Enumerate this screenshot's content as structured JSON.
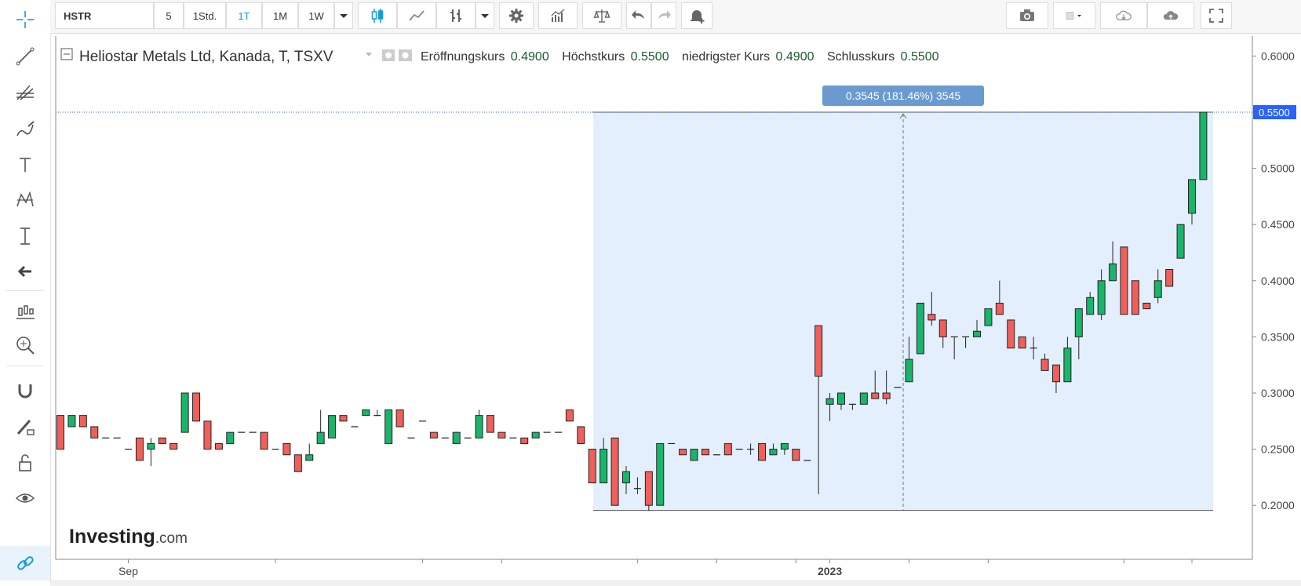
{
  "toolbar": {
    "symbol": "HSTR",
    "intervals": [
      "5",
      "1Std.",
      "1T",
      "1M",
      "1W"
    ],
    "active_interval": "1T",
    "icons": [
      "candles-icon",
      "line-chart-icon",
      "bars-icon",
      "dropdown-icon",
      "gear-icon",
      "indicators-icon",
      "compare-icon",
      "undo-icon",
      "redo-icon",
      "alert-icon",
      "camera-icon",
      "color-box-icon",
      "cloud-download-icon",
      "cloud-upload-icon",
      "fullscreen-icon"
    ]
  },
  "left_tools": [
    "crosshair-icon",
    "trend-line-icon",
    "fib-icon",
    "brush-icon",
    "text-icon",
    "pattern-icon",
    "measure-icon",
    "back-arrow-icon",
    "long-position-icon",
    "zoom-icon",
    "magnet-icon",
    "lock-pencil-icon",
    "lock-icon",
    "eye-icon",
    "link-icon"
  ],
  "legend": {
    "name": "Heliostar Metals Ltd, Kanada, T, TSXV",
    "items": [
      {
        "label": "Eröffnungskurs",
        "value": "0.4900"
      },
      {
        "label": "Höchstkurs",
        "value": "0.5500"
      },
      {
        "label": "niedrigster Kurs",
        "value": "0.4900"
      },
      {
        "label": "Schlusskurs",
        "value": "0.5500"
      }
    ]
  },
  "watermark": {
    "brand": "Investing",
    "suffix": ".com"
  },
  "measure": {
    "label": "0.3545 (181.46%) 3545",
    "low": 0.1955,
    "high": 0.55
  },
  "price_label": "0.5500",
  "colors": {
    "up": "#19b56b",
    "down": "#f0605a",
    "accent": "#2962ff",
    "measure_fill": "#e3effd",
    "measure_tag": "#6a9ad0"
  },
  "chart_data": {
    "type": "candlestick",
    "yaxis_ticks": [
      "0.6000",
      "0.5500",
      "0.5000",
      "0.4500",
      "0.4000",
      "0.3500",
      "0.3000",
      "0.2500",
      "0.2000"
    ],
    "ylim": [
      0.15,
      0.61
    ],
    "xaxis_labels": [
      {
        "label": "Sep",
        "bar": 6
      },
      {
        "label": "2023",
        "bar": 68
      }
    ],
    "candles": [
      [
        0.28,
        0.28,
        0.25,
        0.25
      ],
      [
        0.27,
        0.28,
        0.27,
        0.28
      ],
      [
        0.28,
        0.28,
        0.27,
        0.27
      ],
      [
        0.27,
        0.27,
        0.26,
        0.26
      ],
      [
        0.26,
        0.26,
        0.26,
        0.26
      ],
      [
        0.26,
        0.26,
        0.26,
        0.26
      ],
      [
        0.25,
        0.25,
        0.25,
        0.25
      ],
      [
        0.26,
        0.26,
        0.24,
        0.24
      ],
      [
        0.25,
        0.26,
        0.235,
        0.255
      ],
      [
        0.26,
        0.26,
        0.255,
        0.255
      ],
      [
        0.255,
        0.255,
        0.25,
        0.25
      ],
      [
        0.265,
        0.3,
        0.265,
        0.3
      ],
      [
        0.3,
        0.3,
        0.275,
        0.275
      ],
      [
        0.275,
        0.275,
        0.25,
        0.25
      ],
      [
        0.255,
        0.255,
        0.25,
        0.25
      ],
      [
        0.255,
        0.265,
        0.255,
        0.265
      ],
      [
        0.265,
        0.265,
        0.265,
        0.265
      ],
      [
        0.265,
        0.265,
        0.265,
        0.265
      ],
      [
        0.265,
        0.265,
        0.25,
        0.25
      ],
      [
        0.25,
        0.25,
        0.25,
        0.25
      ],
      [
        0.255,
        0.255,
        0.245,
        0.245
      ],
      [
        0.245,
        0.245,
        0.23,
        0.23
      ],
      [
        0.24,
        0.255,
        0.24,
        0.245
      ],
      [
        0.255,
        0.285,
        0.255,
        0.265
      ],
      [
        0.26,
        0.28,
        0.26,
        0.28
      ],
      [
        0.28,
        0.28,
        0.275,
        0.275
      ],
      [
        0.27,
        0.27,
        0.27,
        0.27
      ],
      [
        0.28,
        0.285,
        0.28,
        0.285
      ],
      [
        0.28,
        0.285,
        0.28,
        0.28
      ],
      [
        0.255,
        0.285,
        0.255,
        0.285
      ],
      [
        0.285,
        0.285,
        0.27,
        0.27
      ],
      [
        0.26,
        0.26,
        0.26,
        0.26
      ],
      [
        0.275,
        0.275,
        0.275,
        0.275
      ],
      [
        0.265,
        0.265,
        0.26,
        0.26
      ],
      [
        0.26,
        0.26,
        0.26,
        0.26
      ],
      [
        0.255,
        0.265,
        0.255,
        0.265
      ],
      [
        0.26,
        0.26,
        0.26,
        0.26
      ],
      [
        0.26,
        0.285,
        0.26,
        0.28
      ],
      [
        0.28,
        0.28,
        0.265,
        0.265
      ],
      [
        0.265,
        0.265,
        0.26,
        0.26
      ],
      [
        0.26,
        0.26,
        0.26,
        0.26
      ],
      [
        0.26,
        0.26,
        0.255,
        0.255
      ],
      [
        0.26,
        0.265,
        0.26,
        0.265
      ],
      [
        0.265,
        0.265,
        0.265,
        0.265
      ],
      [
        0.265,
        0.265,
        0.265,
        0.265
      ],
      [
        0.285,
        0.285,
        0.275,
        0.275
      ],
      [
        0.27,
        0.27,
        0.255,
        0.255
      ],
      [
        0.25,
        0.25,
        0.22,
        0.22
      ],
      [
        0.22,
        0.26,
        0.22,
        0.25
      ],
      [
        0.26,
        0.26,
        0.2,
        0.2
      ],
      [
        0.22,
        0.235,
        0.21,
        0.23
      ],
      [
        0.215,
        0.225,
        0.21,
        0.215
      ],
      [
        0.23,
        0.23,
        0.195,
        0.2
      ],
      [
        0.2,
        0.255,
        0.2,
        0.255
      ],
      [
        0.255,
        0.255,
        0.255,
        0.255
      ],
      [
        0.25,
        0.25,
        0.245,
        0.245
      ],
      [
        0.24,
        0.25,
        0.24,
        0.25
      ],
      [
        0.25,
        0.25,
        0.245,
        0.245
      ],
      [
        0.245,
        0.245,
        0.245,
        0.245
      ],
      [
        0.255,
        0.255,
        0.245,
        0.245
      ],
      [
        0.25,
        0.25,
        0.25,
        0.25
      ],
      [
        0.25,
        0.255,
        0.245,
        0.25
      ],
      [
        0.255,
        0.255,
        0.24,
        0.24
      ],
      [
        0.245,
        0.255,
        0.245,
        0.25
      ],
      [
        0.25,
        0.255,
        0.245,
        0.255
      ],
      [
        0.25,
        0.25,
        0.24,
        0.24
      ],
      [
        0.24,
        0.24,
        0.24,
        0.24
      ],
      [
        0.36,
        0.36,
        0.21,
        0.315
      ],
      [
        0.29,
        0.3,
        0.275,
        0.295
      ],
      [
        0.29,
        0.3,
        0.285,
        0.3
      ],
      [
        0.29,
        0.29,
        0.285,
        0.29
      ],
      [
        0.29,
        0.3,
        0.29,
        0.3
      ],
      [
        0.3,
        0.32,
        0.295,
        0.295
      ],
      [
        0.3,
        0.32,
        0.29,
        0.295
      ],
      [
        0.305,
        0.305,
        0.305,
        0.305
      ],
      [
        0.31,
        0.35,
        0.31,
        0.33
      ],
      [
        0.335,
        0.38,
        0.335,
        0.38
      ],
      [
        0.37,
        0.39,
        0.36,
        0.365
      ],
      [
        0.365,
        0.365,
        0.34,
        0.35
      ],
      [
        0.35,
        0.35,
        0.33,
        0.35
      ],
      [
        0.35,
        0.35,
        0.34,
        0.35
      ],
      [
        0.35,
        0.365,
        0.35,
        0.355
      ],
      [
        0.36,
        0.37,
        0.36,
        0.375
      ],
      [
        0.38,
        0.4,
        0.37,
        0.37
      ],
      [
        0.365,
        0.365,
        0.34,
        0.34
      ],
      [
        0.35,
        0.35,
        0.34,
        0.34
      ],
      [
        0.34,
        0.35,
        0.33,
        0.34
      ],
      [
        0.33,
        0.335,
        0.32,
        0.32
      ],
      [
        0.325,
        0.325,
        0.3,
        0.31
      ],
      [
        0.31,
        0.35,
        0.31,
        0.34
      ],
      [
        0.35,
        0.36,
        0.33,
        0.375
      ],
      [
        0.37,
        0.39,
        0.37,
        0.385
      ],
      [
        0.37,
        0.41,
        0.365,
        0.4
      ],
      [
        0.4,
        0.435,
        0.4,
        0.415
      ],
      [
        0.43,
        0.43,
        0.37,
        0.37
      ],
      [
        0.4,
        0.4,
        0.37,
        0.37
      ],
      [
        0.38,
        0.38,
        0.375,
        0.375
      ],
      [
        0.385,
        0.41,
        0.38,
        0.4
      ],
      [
        0.41,
        0.41,
        0.395,
        0.395
      ],
      [
        0.42,
        0.45,
        0.42,
        0.45
      ],
      [
        0.46,
        0.49,
        0.45,
        0.49
      ],
      [
        0.49,
        0.55,
        0.49,
        0.55
      ]
    ]
  }
}
